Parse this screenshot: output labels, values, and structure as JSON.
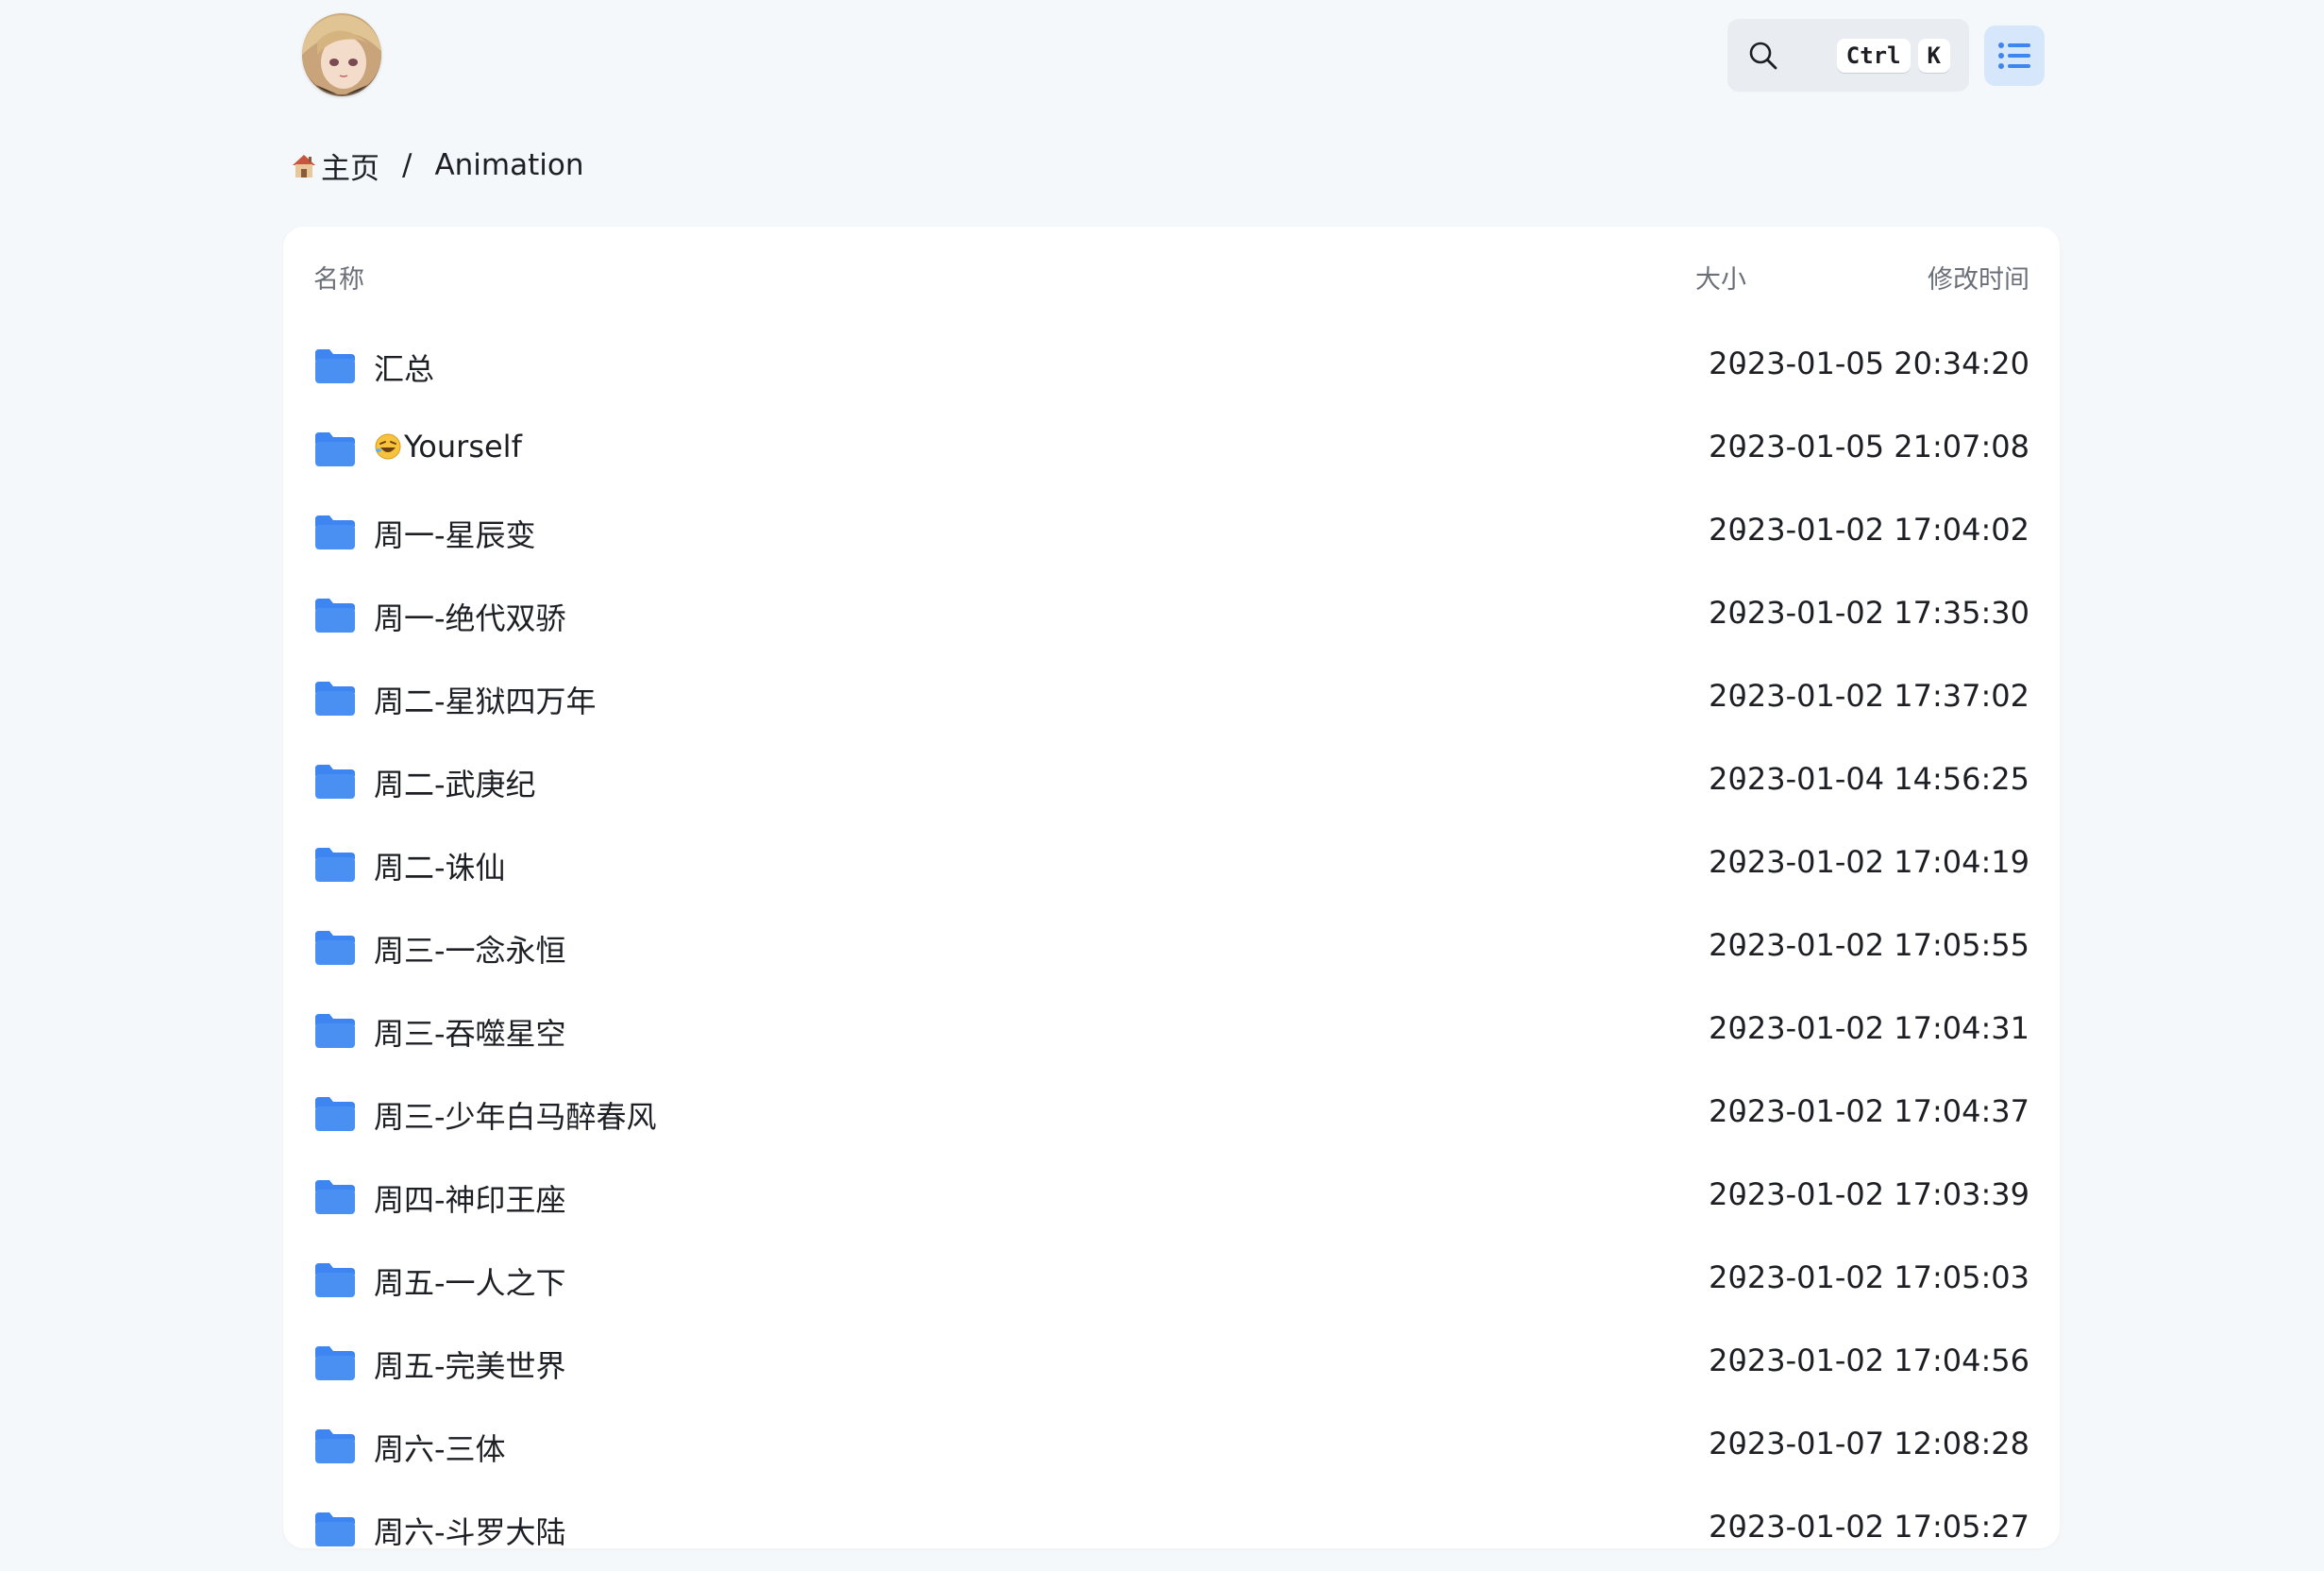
{
  "header": {
    "search_keys": [
      "Ctrl",
      "K"
    ],
    "icons": {
      "search": "search-icon",
      "list": "list-icon"
    }
  },
  "breadcrumb": {
    "home_label": "主页",
    "separator": "/",
    "current": "Animation"
  },
  "table": {
    "columns": {
      "name": "名称",
      "size": "大小",
      "modified": "修改时间"
    },
    "rows": [
      {
        "name": "汇总",
        "size": "-",
        "modified": "2023-01-05 20:34:20"
      },
      {
        "name": "Yourself",
        "emoji": "rofl-emoji",
        "size": "-",
        "modified": "2023-01-05 21:07:08"
      },
      {
        "name": "周一-星辰变",
        "size": "-",
        "modified": "2023-01-02 17:04:02"
      },
      {
        "name": "周一-绝代双骄",
        "size": "-",
        "modified": "2023-01-02 17:35:30"
      },
      {
        "name": "周二-星狱四万年",
        "size": "-",
        "modified": "2023-01-02 17:37:02"
      },
      {
        "name": "周二-武庚纪",
        "size": "-",
        "modified": "2023-01-04 14:56:25"
      },
      {
        "name": "周二-诛仙",
        "size": "-",
        "modified": "2023-01-02 17:04:19"
      },
      {
        "name": "周三-一念永恒",
        "size": "-",
        "modified": "2023-01-02 17:05:55"
      },
      {
        "name": "周三-吞噬星空",
        "size": "-",
        "modified": "2023-01-02 17:04:31"
      },
      {
        "name": "周三-少年白马醉春风",
        "size": "-",
        "modified": "2023-01-02 17:04:37"
      },
      {
        "name": "周四-神印王座",
        "size": "-",
        "modified": "2023-01-02 17:03:39"
      },
      {
        "name": "周五-一人之下",
        "size": "-",
        "modified": "2023-01-02 17:05:03"
      },
      {
        "name": "周五-完美世界",
        "size": "-",
        "modified": "2023-01-02 17:04:56"
      },
      {
        "name": "周六-三体",
        "size": "-",
        "modified": "2023-01-07 12:08:28"
      },
      {
        "name": "周六-斗罗大陆",
        "size": "-",
        "modified": "2023-01-02 17:05:27"
      }
    ]
  },
  "colors": {
    "accent": "#3d85f0",
    "background": "#f5f8fa",
    "card": "#ffffff",
    "muted_text": "#6b7078"
  }
}
